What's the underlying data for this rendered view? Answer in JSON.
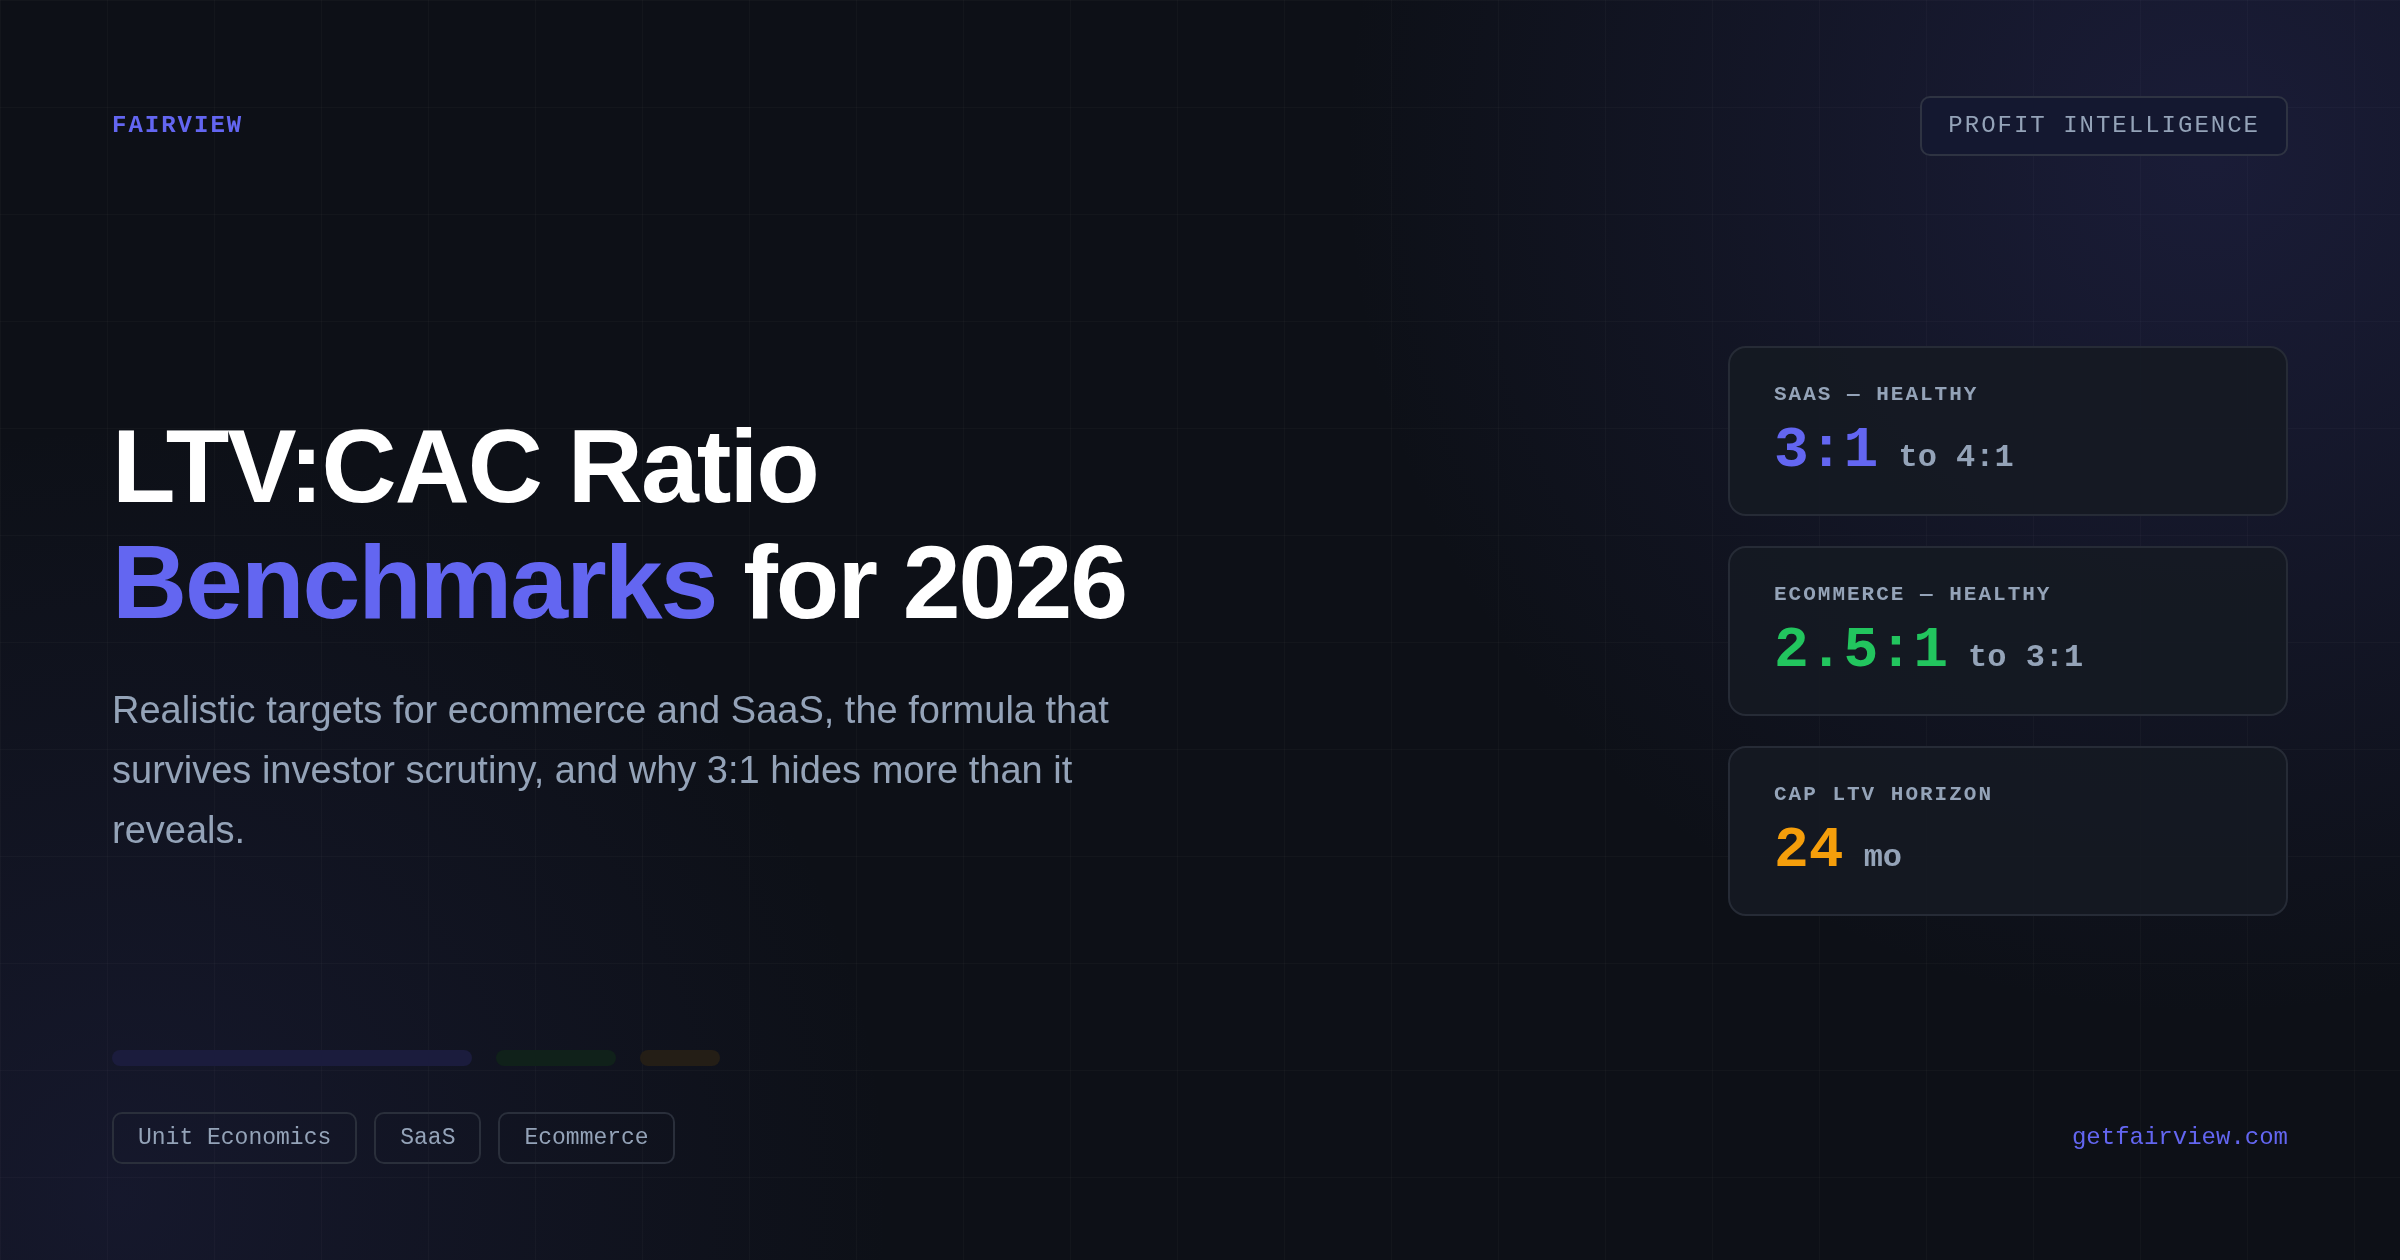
{
  "brand": "FAIRVIEW",
  "badge": "PROFIT INTELLIGENCE",
  "title": {
    "line_1": "LTV:CAC Ratio",
    "highlight": "Benchmarks",
    "rest": "for 2026"
  },
  "subtitle": "Realistic targets for ecommerce and SaaS, the formula that survives investor scrutiny, and why 3:1 hides more than it reveals.",
  "cards": [
    {
      "label": "SAAS — HEALTHY",
      "value": "3:1",
      "suffix": "to 4:1",
      "color": "#6366f1"
    },
    {
      "label": "ECOMMERCE — HEALTHY",
      "value": "2.5:1",
      "suffix": "to 3:1",
      "color": "#22c55e"
    },
    {
      "label": "CAP LTV HORIZON",
      "value": "24",
      "suffix": "mo",
      "color": "#f59e0b"
    }
  ],
  "bars": [
    {
      "color": "#1b1c3d"
    },
    {
      "color": "#10211a"
    },
    {
      "color": "#241e16"
    }
  ],
  "tags": [
    "Unit Economics",
    "SaaS",
    "Ecommerce"
  ],
  "url": "getfairview.com"
}
